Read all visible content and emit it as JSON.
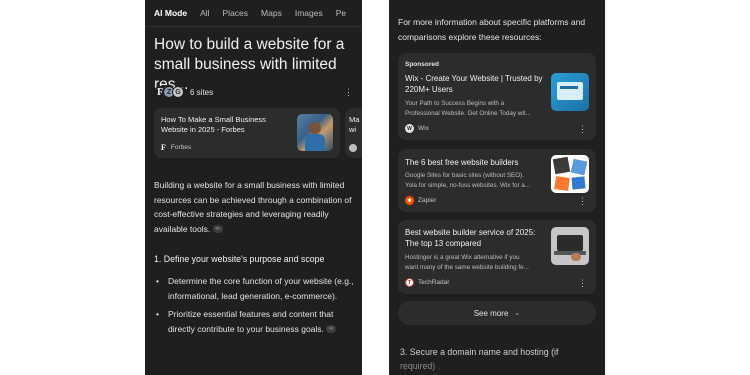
{
  "left": {
    "tabs": [
      {
        "label": "AI Mode",
        "active": true
      },
      {
        "label": "All",
        "active": false
      },
      {
        "label": "Places",
        "active": false
      },
      {
        "label": "Maps",
        "active": false
      },
      {
        "label": "Images",
        "active": false
      },
      {
        "label": "Pe",
        "active": false
      }
    ],
    "title": "How to build a website for a small business with limited res...",
    "sources": {
      "count_label": "6 sites",
      "favicons": [
        "F",
        "Z",
        "G"
      ]
    },
    "source_cards": [
      {
        "title": "How To Make a Small Business Website in 2025 - Forbes",
        "site": "Forbes"
      },
      {
        "title": "Ma\nwi",
        "site": ""
      }
    ],
    "intro_paragraph": "Building a website for a small business with limited resources can be achieved through a combination of cost-effective strategies and leveraging readily available tools.",
    "link_chip": "🔗",
    "step1_heading": "1. Define your website's purpose and scope",
    "step1_bullets": [
      "Determine the core function of your website (e.g., informational, lead generation, e-commerce).",
      "Prioritize essential features and content that directly contribute to your business goals."
    ]
  },
  "right": {
    "intro": "For more information about specific platforms and comparisons explore these resources:",
    "cards": [
      {
        "sponsored": "Sponsored",
        "title": "Wix - Create Your Website | Trusted by 220M+ Users",
        "snippet": "Your Path to Success Begins with a\nProfessional Website. Get Online Today wit...",
        "source": "Wix",
        "icon": "wix-icon"
      },
      {
        "title": "The 6 best free website builders",
        "snippet": "Google Sites for basic sites (without SEO).\nYola for simple, no-fuss websites. Wix for a...",
        "source": "Zapier",
        "icon": "zapier-icon"
      },
      {
        "title": "Best website builder service of 2025: The top 13 compared",
        "snippet": "Hostinger is a great Wix alternative if you\nwant many of the same website building fe...",
        "source": "TechRadar",
        "icon": "techradar-icon"
      }
    ],
    "see_more": "See more",
    "step3": "3. Secure a domain name and hosting (if",
    "step3_cont": "required)"
  },
  "colors": {
    "background": "#1f1f1f",
    "card": "#2c2c2c",
    "text": "#e3e3e3"
  }
}
